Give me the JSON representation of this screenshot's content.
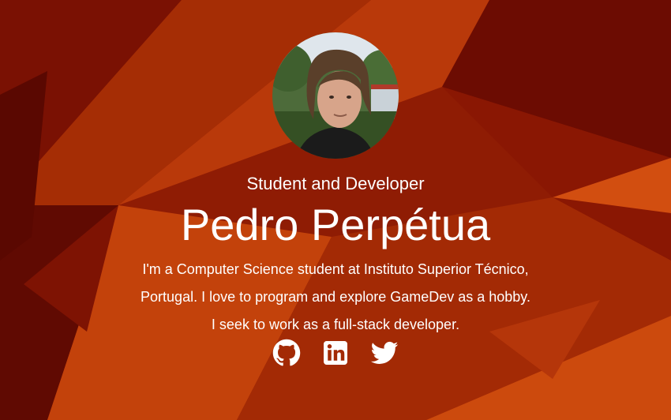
{
  "hero": {
    "subtitle": "Student and Developer",
    "name": "Pedro Perpétua",
    "bio_lines": [
      "I'm a Computer Science student at Instituto Superior Técnico,",
      "Portugal. I love to program and explore GameDev as a hobby.",
      "I seek to work as a full-stack developer."
    ]
  },
  "social": [
    {
      "icon": "github-icon"
    },
    {
      "icon": "linkedin-icon"
    },
    {
      "icon": "twitter-icon"
    }
  ],
  "colors": {
    "text": "#ffffff",
    "background_dark": "#6e0e02",
    "background_mid": "#a82e04",
    "background_light": "#c9440a"
  }
}
